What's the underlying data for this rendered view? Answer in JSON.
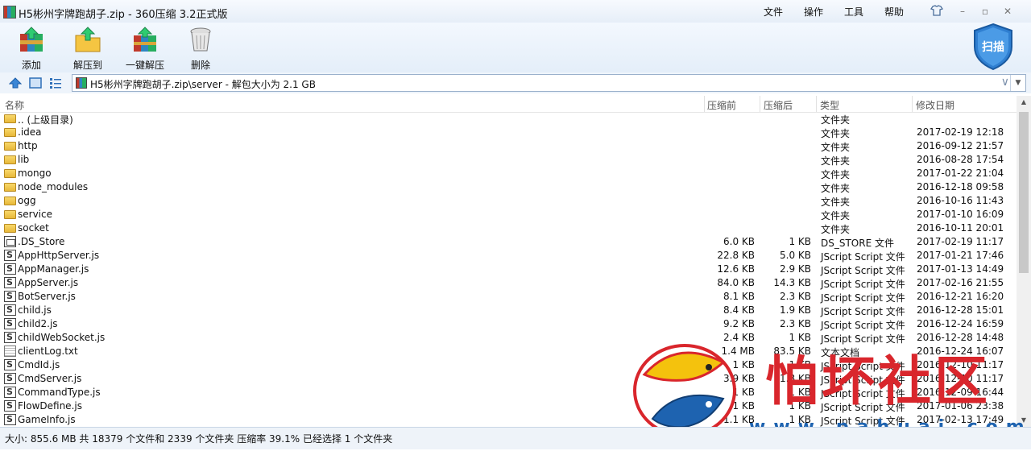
{
  "window": {
    "title": "H5彬州字牌跑胡子.zip - 360压缩 3.2正式版",
    "menu": [
      "文件",
      "操作",
      "工具",
      "帮助"
    ]
  },
  "toolbar": {
    "add_label": "添加",
    "extract_to_label": "解压到",
    "one_click_extract_label": "一键解压",
    "delete_label": "删除",
    "scan_label": "扫描"
  },
  "address": {
    "path": "H5彬州字牌跑胡子.zip\\server - 解包大小为 2.1 GB"
  },
  "columns": {
    "name": "名称",
    "packed": "压缩前",
    "unpacked": "压缩后",
    "type": "类型",
    "modified": "修改日期"
  },
  "rows": [
    {
      "kind": "folder",
      "name": ".. (上级目录)",
      "packed": "",
      "unpacked": "",
      "type": "文件夹",
      "date": ""
    },
    {
      "kind": "folder",
      "name": ".idea",
      "packed": "",
      "unpacked": "",
      "type": "文件夹",
      "date": "2017-02-19 12:18"
    },
    {
      "kind": "folder",
      "name": "http",
      "packed": "",
      "unpacked": "",
      "type": "文件夹",
      "date": "2016-09-12 21:57"
    },
    {
      "kind": "folder",
      "name": "lib",
      "packed": "",
      "unpacked": "",
      "type": "文件夹",
      "date": "2016-08-28 17:54"
    },
    {
      "kind": "folder",
      "name": "mongo",
      "packed": "",
      "unpacked": "",
      "type": "文件夹",
      "date": "2017-01-22 21:04"
    },
    {
      "kind": "folder",
      "name": "node_modules",
      "packed": "",
      "unpacked": "",
      "type": "文件夹",
      "date": "2016-12-18 09:58"
    },
    {
      "kind": "folder",
      "name": "ogg",
      "packed": "",
      "unpacked": "",
      "type": "文件夹",
      "date": "2016-10-16 11:43"
    },
    {
      "kind": "folder",
      "name": "service",
      "packed": "",
      "unpacked": "",
      "type": "文件夹",
      "date": "2017-01-10 16:09"
    },
    {
      "kind": "folder",
      "name": "socket",
      "packed": "",
      "unpacked": "",
      "type": "文件夹",
      "date": "2016-10-11 20:01"
    },
    {
      "kind": "ds",
      "name": ".DS_Store",
      "packed": "6.0 KB",
      "unpacked": "1 KB",
      "type": "DS_STORE 文件",
      "date": "2017-02-19 11:17"
    },
    {
      "kind": "js",
      "name": "AppHttpServer.js",
      "packed": "22.8 KB",
      "unpacked": "5.0 KB",
      "type": "JScript Script 文件",
      "date": "2017-01-21 17:46"
    },
    {
      "kind": "js",
      "name": "AppManager.js",
      "packed": "12.6 KB",
      "unpacked": "2.9 KB",
      "type": "JScript Script 文件",
      "date": "2017-01-13 14:49"
    },
    {
      "kind": "js",
      "name": "AppServer.js",
      "packed": "84.0 KB",
      "unpacked": "14.3 KB",
      "type": "JScript Script 文件",
      "date": "2017-02-16 21:55"
    },
    {
      "kind": "js",
      "name": "BotServer.js",
      "packed": "8.1 KB",
      "unpacked": "2.3 KB",
      "type": "JScript Script 文件",
      "date": "2016-12-21 16:20"
    },
    {
      "kind": "js",
      "name": "child.js",
      "packed": "8.4 KB",
      "unpacked": "1.9 KB",
      "type": "JScript Script 文件",
      "date": "2016-12-28 15:01"
    },
    {
      "kind": "js",
      "name": "child2.js",
      "packed": "9.2 KB",
      "unpacked": "2.3 KB",
      "type": "JScript Script 文件",
      "date": "2016-12-24 16:59"
    },
    {
      "kind": "js",
      "name": "childWebSocket.js",
      "packed": "2.4 KB",
      "unpacked": "1 KB",
      "type": "JScript Script 文件",
      "date": "2016-12-28 14:48"
    },
    {
      "kind": "txt",
      "name": "clientLog.txt",
      "packed": "1.4 MB",
      "unpacked": "83.5 KB",
      "type": "文本文档",
      "date": "2016-12-24 16:07"
    },
    {
      "kind": "js",
      "name": "CmdId.js",
      "packed": "1 KB",
      "unpacked": "1 KB",
      "type": "JScript Script 文件",
      "date": "2016-12-10 11:17"
    },
    {
      "kind": "js",
      "name": "CmdServer.js",
      "packed": "3.9 KB",
      "unpacked": "1.8 KB",
      "type": "JScript Script 文件",
      "date": "2016-12-10 11:17"
    },
    {
      "kind": "js",
      "name": "CommandType.js",
      "packed": "1 KB",
      "unpacked": "1 KB",
      "type": "JScript Script 文件",
      "date": "2016-12-09 16:44"
    },
    {
      "kind": "js",
      "name": "FlowDefine.js",
      "packed": "1 KB",
      "unpacked": "1 KB",
      "type": "JScript Script 文件",
      "date": "2017-01-06 23:38"
    },
    {
      "kind": "js",
      "name": "GameInfo.js",
      "packed": "1.1 KB",
      "unpacked": "1 KB",
      "type": "JScript Script 文件",
      "date": "2017-02-13 17:49"
    }
  ],
  "status": {
    "text": "大小: 855.6 MB 共 18379 个文件和 2339 个文件夹 压缩率 39.1% 已经选择 1 个文件夹"
  },
  "watermark": {
    "title": "怕坏社区",
    "url": "www.pahuai.com"
  },
  "colors": {
    "toolbar_bg": "#e4eef9",
    "address_border": "#9bb1cc",
    "folder": "#f0c44a",
    "watermark_red": "#d9262c",
    "watermark_blue": "#1e63b0"
  }
}
